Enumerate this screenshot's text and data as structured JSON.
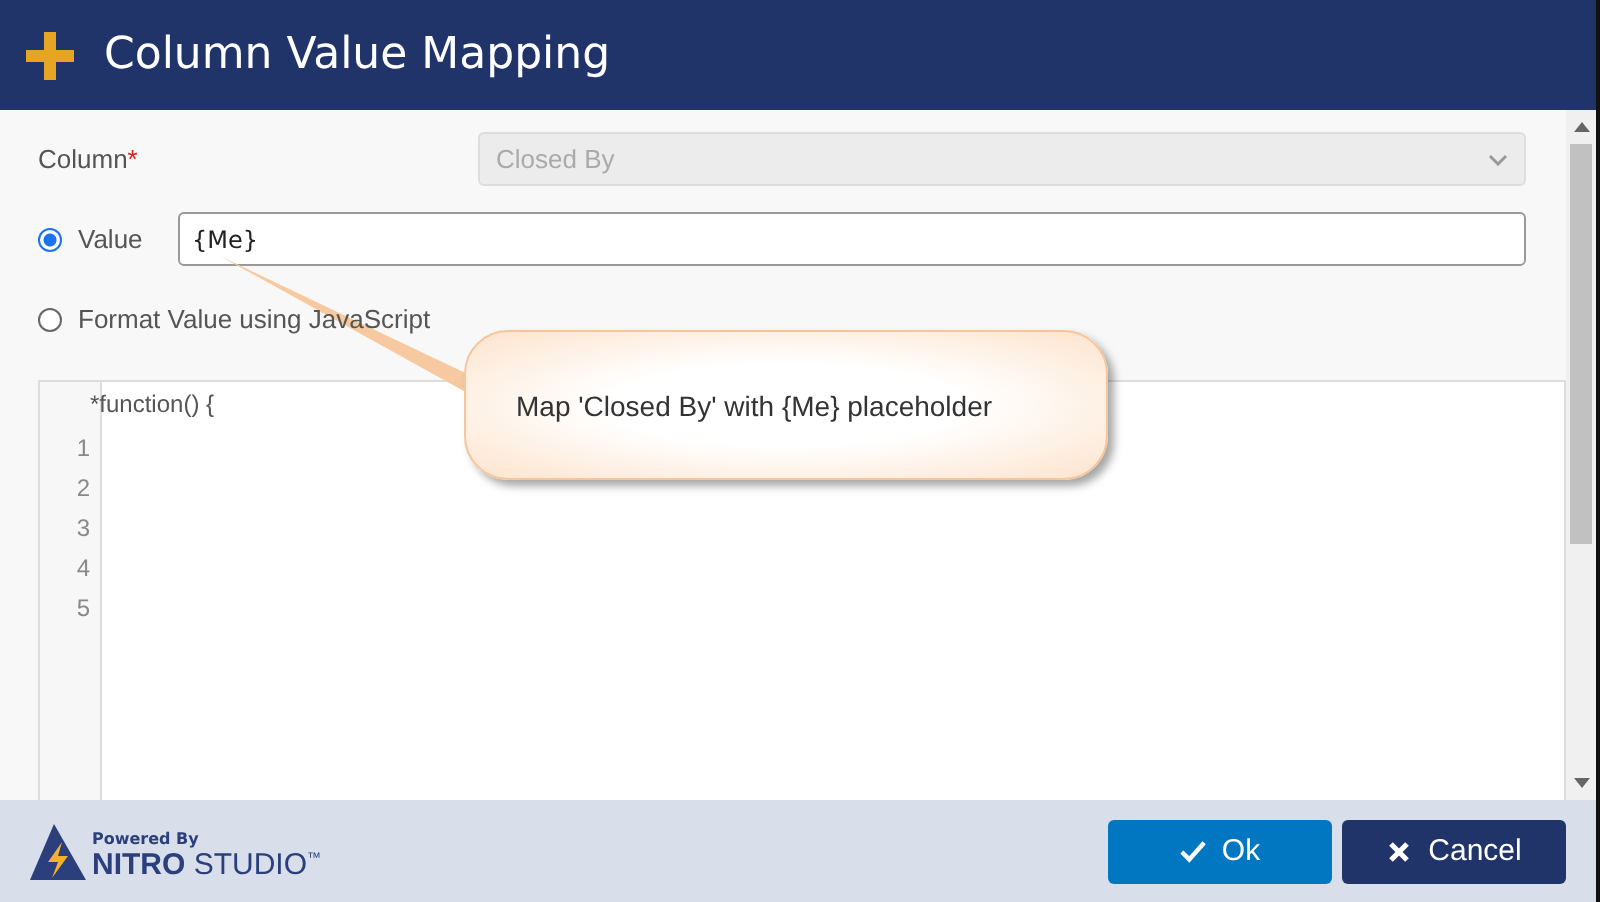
{
  "window": {
    "title": "Column Value Mapping"
  },
  "column": {
    "label": "Column",
    "required_mark": "*",
    "value": "Closed By",
    "disabled": true
  },
  "options": [
    {
      "label": "Value",
      "selected": true,
      "kind": "input",
      "value": "{Me}"
    },
    {
      "label": "Format Value using JavaScript",
      "selected": false,
      "kind": "plain"
    }
  ],
  "editor": {
    "header": "*function() {",
    "line_numbers": [
      "1",
      "2",
      "3",
      "4",
      "5"
    ]
  },
  "callout": {
    "text": "Map 'Closed By' with {Me} placeholder"
  },
  "footer": {
    "powered_by": "Powered By",
    "brand_bold": "NITRO",
    "brand_light": "STUDIO",
    "trademark": "™"
  },
  "buttons": [
    {
      "label": "Ok",
      "kind": "ok"
    },
    {
      "label": "Cancel",
      "kind": "cancel"
    }
  ]
}
